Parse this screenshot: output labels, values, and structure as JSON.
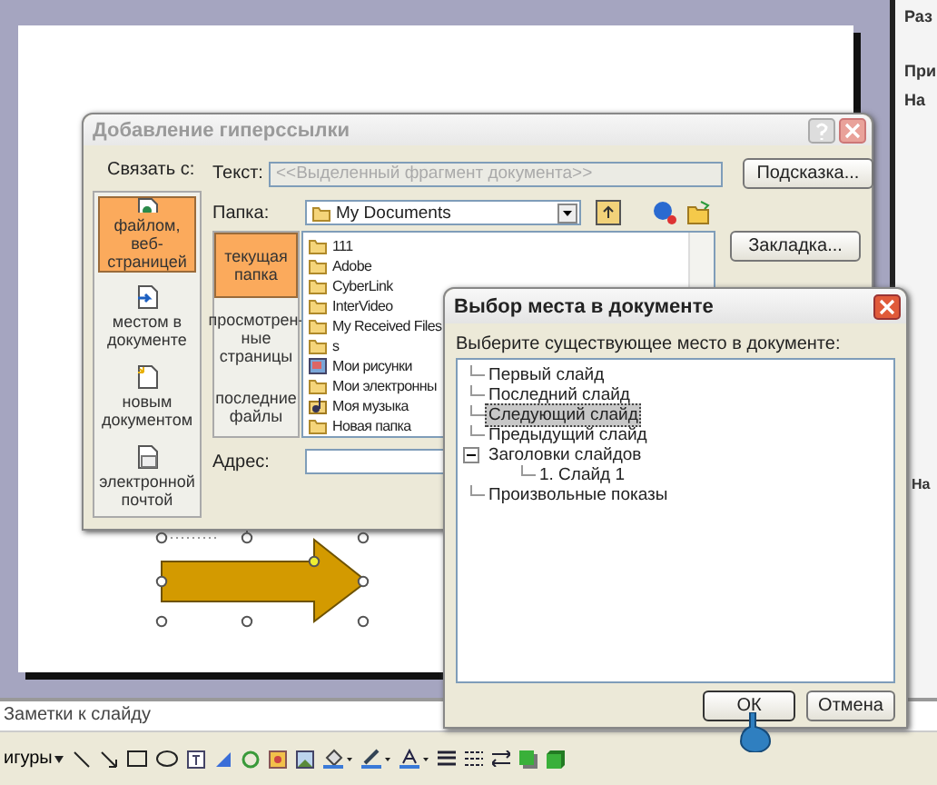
{
  "task_pane": {
    "labels": [
      "Раз",
      "При",
      "На",
      "На"
    ]
  },
  "hyperlink_dialog": {
    "title": "Добавление гиперссылки",
    "link_to_label": "Связать с:",
    "link_to": [
      {
        "label": "файлом, веб-страницей",
        "kind": "file",
        "selected": true
      },
      {
        "label": "местом в документе",
        "kind": "place",
        "selected": false
      },
      {
        "label": "новым документом",
        "kind": "new",
        "selected": false
      },
      {
        "label": "электронной почтой",
        "kind": "mail",
        "selected": false
      }
    ],
    "text_label": "Текст:",
    "text_value": "<<Выделенный фрагмент документа>>",
    "hint_button": "Подсказка...",
    "folder_label": "Папка:",
    "folder_value": "My Documents",
    "bookmark_button": "Закладка...",
    "sections": [
      {
        "label": "текущая папка",
        "selected": true
      },
      {
        "label": "просмотрен-ные страницы",
        "selected": false
      },
      {
        "label": "последние файлы",
        "selected": false
      }
    ],
    "files": [
      {
        "name": "111",
        "kind": "folder"
      },
      {
        "name": "Adobe",
        "kind": "folder"
      },
      {
        "name": "CyberLink",
        "kind": "folder"
      },
      {
        "name": "InterVideo",
        "kind": "folder"
      },
      {
        "name": "My Received Files",
        "kind": "folder"
      },
      {
        "name": "s",
        "kind": "folder"
      },
      {
        "name": "Мои рисунки",
        "kind": "pictures"
      },
      {
        "name": "Мои электронны",
        "kind": "folder"
      },
      {
        "name": "Моя музыка",
        "kind": "music"
      },
      {
        "name": "Новая папка",
        "kind": "folder"
      }
    ],
    "address_label": "Адрес:"
  },
  "place_dialog": {
    "title": "Выбор места в документе",
    "prompt": "Выберите существующее место в документе:",
    "tree": [
      {
        "label": "Первый слайд",
        "selected": false
      },
      {
        "label": "Последний слайд",
        "selected": false
      },
      {
        "label": "Следующий слайд",
        "selected": true
      },
      {
        "label": "Предыдущий слайд",
        "selected": false
      },
      {
        "label": "Заголовки слайдов",
        "selected": false,
        "expanded": true,
        "children": [
          {
            "label": "1. Слайд 1",
            "selected": false
          }
        ]
      },
      {
        "label": "Произвольные показы",
        "selected": false
      }
    ],
    "ok_button": "ОК",
    "cancel_button": "Отмена"
  },
  "notes": "Заметки к слайду",
  "drawing_toolbar": {
    "label": "игуры"
  }
}
